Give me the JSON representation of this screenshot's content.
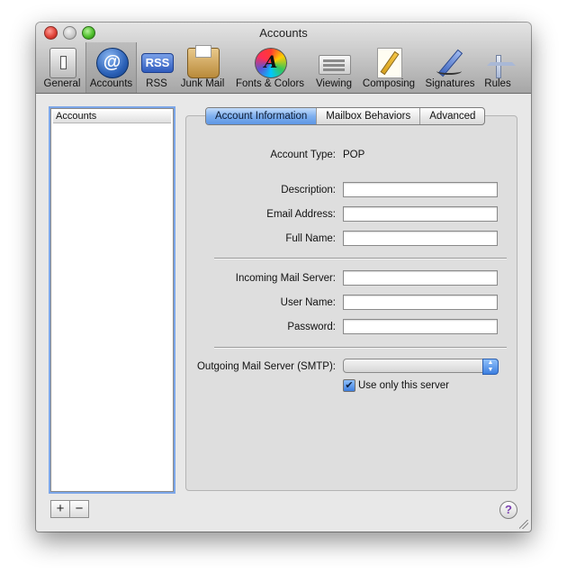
{
  "window": {
    "title": "Accounts"
  },
  "toolbar": {
    "items": [
      {
        "label": "General",
        "icon": "light-switch-icon"
      },
      {
        "label": "Accounts",
        "icon": "at-sign-icon"
      },
      {
        "label": "RSS",
        "icon": "rss-icon"
      },
      {
        "label": "Junk Mail",
        "icon": "junk-mail-bag-icon"
      },
      {
        "label": "Fonts & Colors",
        "icon": "color-wheel-icon"
      },
      {
        "label": "Viewing",
        "icon": "viewing-icon"
      },
      {
        "label": "Composing",
        "icon": "pencil-paper-icon"
      },
      {
        "label": "Signatures",
        "icon": "fountain-pen-icon"
      },
      {
        "label": "Rules",
        "icon": "signpost-icon"
      }
    ],
    "selected": "Accounts"
  },
  "sidebar": {
    "header": "Accounts",
    "add_label": "+",
    "remove_label": "−"
  },
  "tabs": [
    {
      "label": "Account Information",
      "active": true
    },
    {
      "label": "Mailbox Behaviors",
      "active": false
    },
    {
      "label": "Advanced",
      "active": false
    }
  ],
  "form": {
    "account_type_label": "Account Type:",
    "account_type_value": "POP",
    "description_label": "Description:",
    "email_label": "Email Address:",
    "fullname_label": "Full Name:",
    "incoming_label": "Incoming Mail Server:",
    "username_label": "User Name:",
    "password_label": "Password:",
    "smtp_label": "Outgoing Mail Server (SMTP):",
    "smtp_value": "",
    "use_only_label": "Use only this server",
    "use_only_checked": true,
    "checkmark": "✔"
  },
  "help": {
    "label": "?"
  },
  "colors": {
    "accent": "#5d96e4",
    "window_bg": "#e8e8e8"
  }
}
